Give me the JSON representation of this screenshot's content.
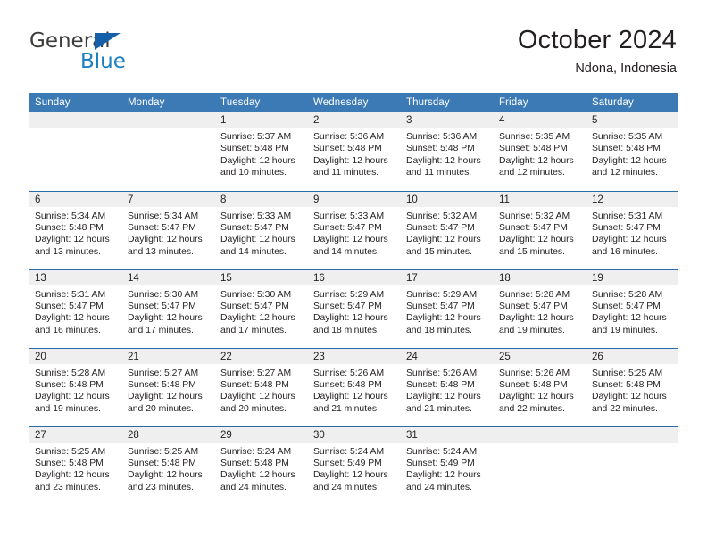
{
  "brand": {
    "name_top": "General",
    "name_bottom": "Blue",
    "color_dark": "#3c3c3b",
    "color_blue": "#1a7fc1",
    "triangle_color": "#1560a8"
  },
  "header": {
    "title": "October 2024",
    "subtitle": "Ndona, Indonesia"
  },
  "theme": {
    "header_blue": "#3b7ab5",
    "row_divider": "#2a6ca8",
    "daynum_band": "#efefef",
    "text": "#231f20"
  },
  "weekdays": [
    "Sunday",
    "Monday",
    "Tuesday",
    "Wednesday",
    "Thursday",
    "Friday",
    "Saturday"
  ],
  "labels": {
    "sunrise_prefix": "Sunrise:",
    "sunset_prefix": "Sunset:",
    "daylight_prefix": "Daylight:"
  },
  "weeks": [
    [
      {
        "day": "",
        "sunrise": "",
        "sunset": "",
        "daylight_line1": "",
        "daylight_line2": ""
      },
      {
        "day": "",
        "sunrise": "",
        "sunset": "",
        "daylight_line1": "",
        "daylight_line2": ""
      },
      {
        "day": "1",
        "sunrise": "Sunrise: 5:37 AM",
        "sunset": "Sunset: 5:48 PM",
        "daylight_line1": "Daylight: 12 hours",
        "daylight_line2": "and 10 minutes."
      },
      {
        "day": "2",
        "sunrise": "Sunrise: 5:36 AM",
        "sunset": "Sunset: 5:48 PM",
        "daylight_line1": "Daylight: 12 hours",
        "daylight_line2": "and 11 minutes."
      },
      {
        "day": "3",
        "sunrise": "Sunrise: 5:36 AM",
        "sunset": "Sunset: 5:48 PM",
        "daylight_line1": "Daylight: 12 hours",
        "daylight_line2": "and 11 minutes."
      },
      {
        "day": "4",
        "sunrise": "Sunrise: 5:35 AM",
        "sunset": "Sunset: 5:48 PM",
        "daylight_line1": "Daylight: 12 hours",
        "daylight_line2": "and 12 minutes."
      },
      {
        "day": "5",
        "sunrise": "Sunrise: 5:35 AM",
        "sunset": "Sunset: 5:48 PM",
        "daylight_line1": "Daylight: 12 hours",
        "daylight_line2": "and 12 minutes."
      }
    ],
    [
      {
        "day": "6",
        "sunrise": "Sunrise: 5:34 AM",
        "sunset": "Sunset: 5:48 PM",
        "daylight_line1": "Daylight: 12 hours",
        "daylight_line2": "and 13 minutes."
      },
      {
        "day": "7",
        "sunrise": "Sunrise: 5:34 AM",
        "sunset": "Sunset: 5:47 PM",
        "daylight_line1": "Daylight: 12 hours",
        "daylight_line2": "and 13 minutes."
      },
      {
        "day": "8",
        "sunrise": "Sunrise: 5:33 AM",
        "sunset": "Sunset: 5:47 PM",
        "daylight_line1": "Daylight: 12 hours",
        "daylight_line2": "and 14 minutes."
      },
      {
        "day": "9",
        "sunrise": "Sunrise: 5:33 AM",
        "sunset": "Sunset: 5:47 PM",
        "daylight_line1": "Daylight: 12 hours",
        "daylight_line2": "and 14 minutes."
      },
      {
        "day": "10",
        "sunrise": "Sunrise: 5:32 AM",
        "sunset": "Sunset: 5:47 PM",
        "daylight_line1": "Daylight: 12 hours",
        "daylight_line2": "and 15 minutes."
      },
      {
        "day": "11",
        "sunrise": "Sunrise: 5:32 AM",
        "sunset": "Sunset: 5:47 PM",
        "daylight_line1": "Daylight: 12 hours",
        "daylight_line2": "and 15 minutes."
      },
      {
        "day": "12",
        "sunrise": "Sunrise: 5:31 AM",
        "sunset": "Sunset: 5:47 PM",
        "daylight_line1": "Daylight: 12 hours",
        "daylight_line2": "and 16 minutes."
      }
    ],
    [
      {
        "day": "13",
        "sunrise": "Sunrise: 5:31 AM",
        "sunset": "Sunset: 5:47 PM",
        "daylight_line1": "Daylight: 12 hours",
        "daylight_line2": "and 16 minutes."
      },
      {
        "day": "14",
        "sunrise": "Sunrise: 5:30 AM",
        "sunset": "Sunset: 5:47 PM",
        "daylight_line1": "Daylight: 12 hours",
        "daylight_line2": "and 17 minutes."
      },
      {
        "day": "15",
        "sunrise": "Sunrise: 5:30 AM",
        "sunset": "Sunset: 5:47 PM",
        "daylight_line1": "Daylight: 12 hours",
        "daylight_line2": "and 17 minutes."
      },
      {
        "day": "16",
        "sunrise": "Sunrise: 5:29 AM",
        "sunset": "Sunset: 5:47 PM",
        "daylight_line1": "Daylight: 12 hours",
        "daylight_line2": "and 18 minutes."
      },
      {
        "day": "17",
        "sunrise": "Sunrise: 5:29 AM",
        "sunset": "Sunset: 5:47 PM",
        "daylight_line1": "Daylight: 12 hours",
        "daylight_line2": "and 18 minutes."
      },
      {
        "day": "18",
        "sunrise": "Sunrise: 5:28 AM",
        "sunset": "Sunset: 5:47 PM",
        "daylight_line1": "Daylight: 12 hours",
        "daylight_line2": "and 19 minutes."
      },
      {
        "day": "19",
        "sunrise": "Sunrise: 5:28 AM",
        "sunset": "Sunset: 5:47 PM",
        "daylight_line1": "Daylight: 12 hours",
        "daylight_line2": "and 19 minutes."
      }
    ],
    [
      {
        "day": "20",
        "sunrise": "Sunrise: 5:28 AM",
        "sunset": "Sunset: 5:48 PM",
        "daylight_line1": "Daylight: 12 hours",
        "daylight_line2": "and 19 minutes."
      },
      {
        "day": "21",
        "sunrise": "Sunrise: 5:27 AM",
        "sunset": "Sunset: 5:48 PM",
        "daylight_line1": "Daylight: 12 hours",
        "daylight_line2": "and 20 minutes."
      },
      {
        "day": "22",
        "sunrise": "Sunrise: 5:27 AM",
        "sunset": "Sunset: 5:48 PM",
        "daylight_line1": "Daylight: 12 hours",
        "daylight_line2": "and 20 minutes."
      },
      {
        "day": "23",
        "sunrise": "Sunrise: 5:26 AM",
        "sunset": "Sunset: 5:48 PM",
        "daylight_line1": "Daylight: 12 hours",
        "daylight_line2": "and 21 minutes."
      },
      {
        "day": "24",
        "sunrise": "Sunrise: 5:26 AM",
        "sunset": "Sunset: 5:48 PM",
        "daylight_line1": "Daylight: 12 hours",
        "daylight_line2": "and 21 minutes."
      },
      {
        "day": "25",
        "sunrise": "Sunrise: 5:26 AM",
        "sunset": "Sunset: 5:48 PM",
        "daylight_line1": "Daylight: 12 hours",
        "daylight_line2": "and 22 minutes."
      },
      {
        "day": "26",
        "sunrise": "Sunrise: 5:25 AM",
        "sunset": "Sunset: 5:48 PM",
        "daylight_line1": "Daylight: 12 hours",
        "daylight_line2": "and 22 minutes."
      }
    ],
    [
      {
        "day": "27",
        "sunrise": "Sunrise: 5:25 AM",
        "sunset": "Sunset: 5:48 PM",
        "daylight_line1": "Daylight: 12 hours",
        "daylight_line2": "and 23 minutes."
      },
      {
        "day": "28",
        "sunrise": "Sunrise: 5:25 AM",
        "sunset": "Sunset: 5:48 PM",
        "daylight_line1": "Daylight: 12 hours",
        "daylight_line2": "and 23 minutes."
      },
      {
        "day": "29",
        "sunrise": "Sunrise: 5:24 AM",
        "sunset": "Sunset: 5:48 PM",
        "daylight_line1": "Daylight: 12 hours",
        "daylight_line2": "and 24 minutes."
      },
      {
        "day": "30",
        "sunrise": "Sunrise: 5:24 AM",
        "sunset": "Sunset: 5:49 PM",
        "daylight_line1": "Daylight: 12 hours",
        "daylight_line2": "and 24 minutes."
      },
      {
        "day": "31",
        "sunrise": "Sunrise: 5:24 AM",
        "sunset": "Sunset: 5:49 PM",
        "daylight_line1": "Daylight: 12 hours",
        "daylight_line2": "and 24 minutes."
      },
      {
        "day": "",
        "sunrise": "",
        "sunset": "",
        "daylight_line1": "",
        "daylight_line2": ""
      },
      {
        "day": "",
        "sunrise": "",
        "sunset": "",
        "daylight_line1": "",
        "daylight_line2": ""
      }
    ]
  ]
}
